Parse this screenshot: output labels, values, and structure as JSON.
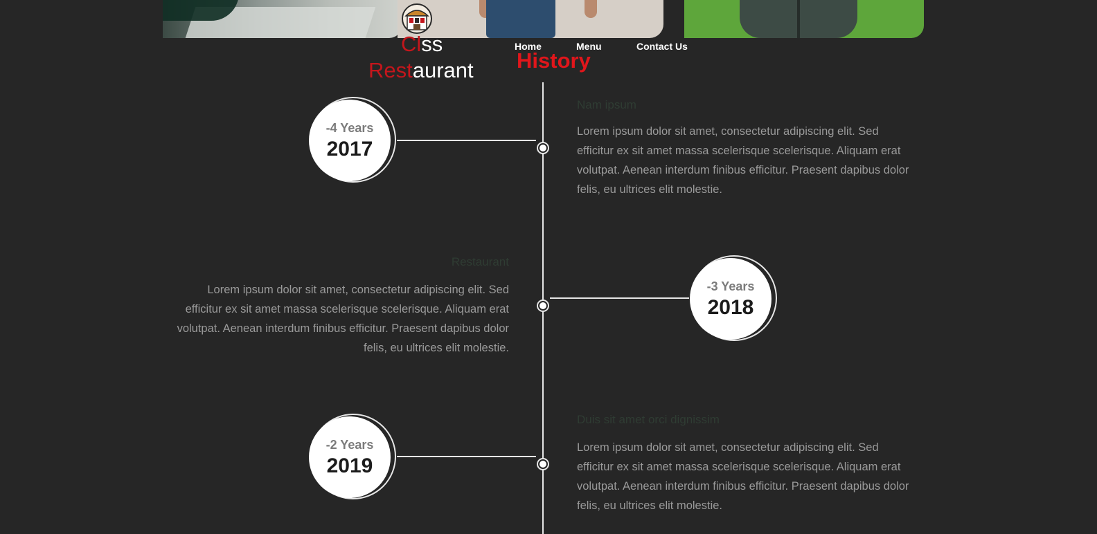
{
  "brand": {
    "line1": {
      "accent": "Cl",
      "rest": "ss"
    },
    "line2": {
      "accent": "Rest",
      "rest": "aurant"
    }
  },
  "nav": {
    "home": "Home",
    "menu": "Menu",
    "contact": "Contact Us"
  },
  "page_title": "History",
  "colors": {
    "background": "#262626",
    "accent": "#e0161b",
    "timeline": "#e6e6e6"
  },
  "timeline": [
    {
      "years_ago": "-4 Years",
      "year": "2017",
      "title": "Nam ipsum",
      "body": "Lorem ipsum dolor sit amet, consectetur adipiscing elit. Sed efficitur ex sit amet massa scelerisque scelerisque. Aliquam erat volutpat. Aenean interdum finibus efficitur. Praesent dapibus dolor felis, eu ultrices elit molestie."
    },
    {
      "years_ago": "-3 Years",
      "year": "2018",
      "title": "Restaurant",
      "body": "Lorem ipsum dolor sit amet, consectetur adipiscing elit. Sed efficitur ex sit amet massa scelerisque scelerisque. Aliquam erat volutpat. Aenean interdum finibus efficitur. Praesent dapibus dolor felis, eu ultrices elit molestie."
    },
    {
      "years_ago": "-2 Years",
      "year": "2019",
      "title": "Duis sit amet orci dignissim",
      "body": "Lorem ipsum dolor sit amet, consectetur adipiscing elit. Sed efficitur ex sit amet massa scelerisque scelerisque. Aliquam erat volutpat. Aenean interdum finibus efficitur. Praesent dapibus dolor felis, eu ultrices elit molestie."
    }
  ]
}
